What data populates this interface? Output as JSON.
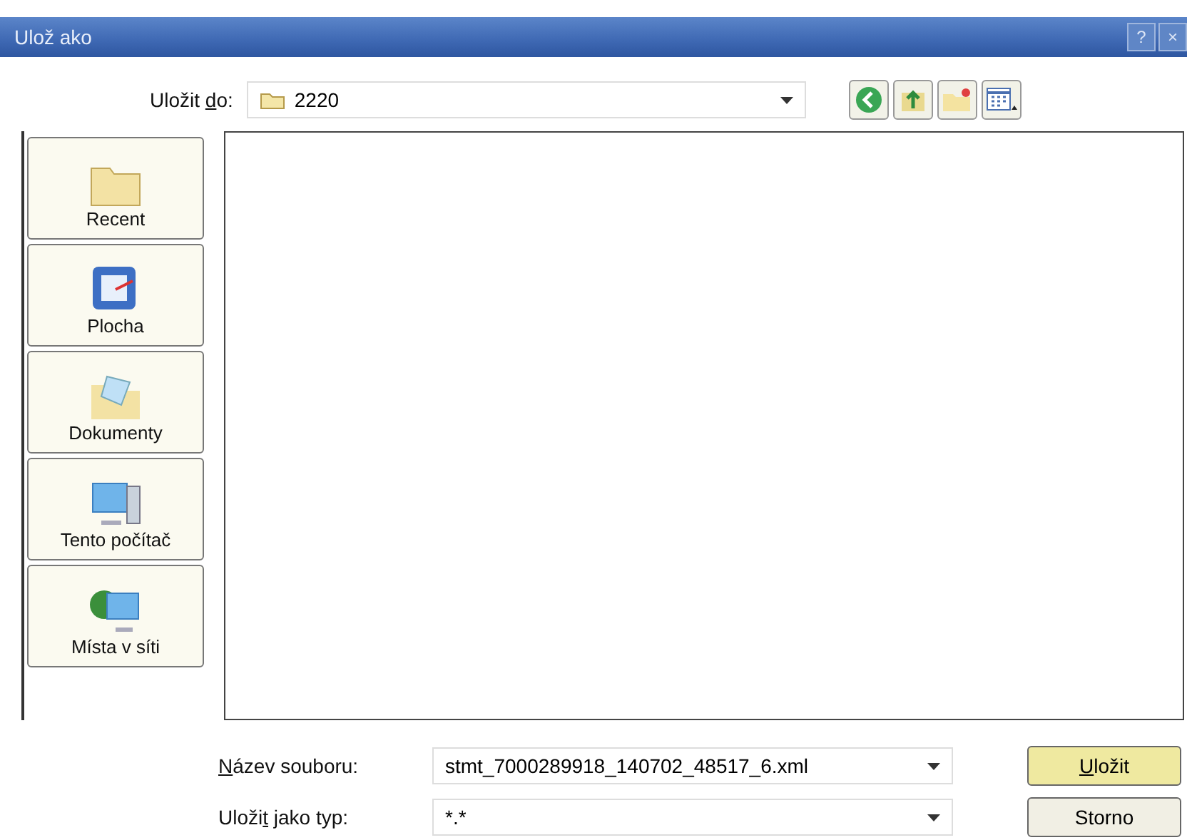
{
  "window": {
    "title": "Ulož ako",
    "controls": [
      "?",
      "×"
    ]
  },
  "save_in": {
    "label": [
      {
        "text": "Uložit ",
        "underlined": false
      },
      {
        "text": "d",
        "underlined": true
      },
      {
        "text": "o:",
        "underlined": false
      }
    ],
    "value": "2220"
  },
  "toolbar": [
    {
      "kind": "back"
    },
    {
      "kind": "up"
    },
    {
      "kind": "new-folder"
    },
    {
      "kind": "views"
    }
  ],
  "places": [
    {
      "label": "Recent",
      "kind": "recent"
    },
    {
      "label": "Plocha",
      "kind": "desktop"
    },
    {
      "label": "Dokumenty",
      "kind": "documents"
    },
    {
      "label": "Tento počítač",
      "kind": "computer"
    },
    {
      "label": "Místa v síti",
      "kind": "network"
    }
  ],
  "fields": [
    {
      "label": [
        {
          "text": "N",
          "underlined": true
        },
        {
          "text": "ázev souboru:",
          "underlined": false
        }
      ],
      "value": "stmt_7000289918_140702_48517_6.xml"
    },
    {
      "label": [
        {
          "text": "Uloži",
          "underlined": false
        },
        {
          "text": "t",
          "underlined": true
        },
        {
          "text": " jako typ:",
          "underlined": false
        }
      ],
      "value": "*.*"
    }
  ],
  "buttons": [
    {
      "label": [
        {
          "text": "U",
          "underlined": true
        },
        {
          "text": "ložit",
          "underlined": false
        }
      ],
      "default": true
    },
    {
      "label": [
        {
          "text": "Storno",
          "underlined": false
        }
      ],
      "default": false
    }
  ]
}
